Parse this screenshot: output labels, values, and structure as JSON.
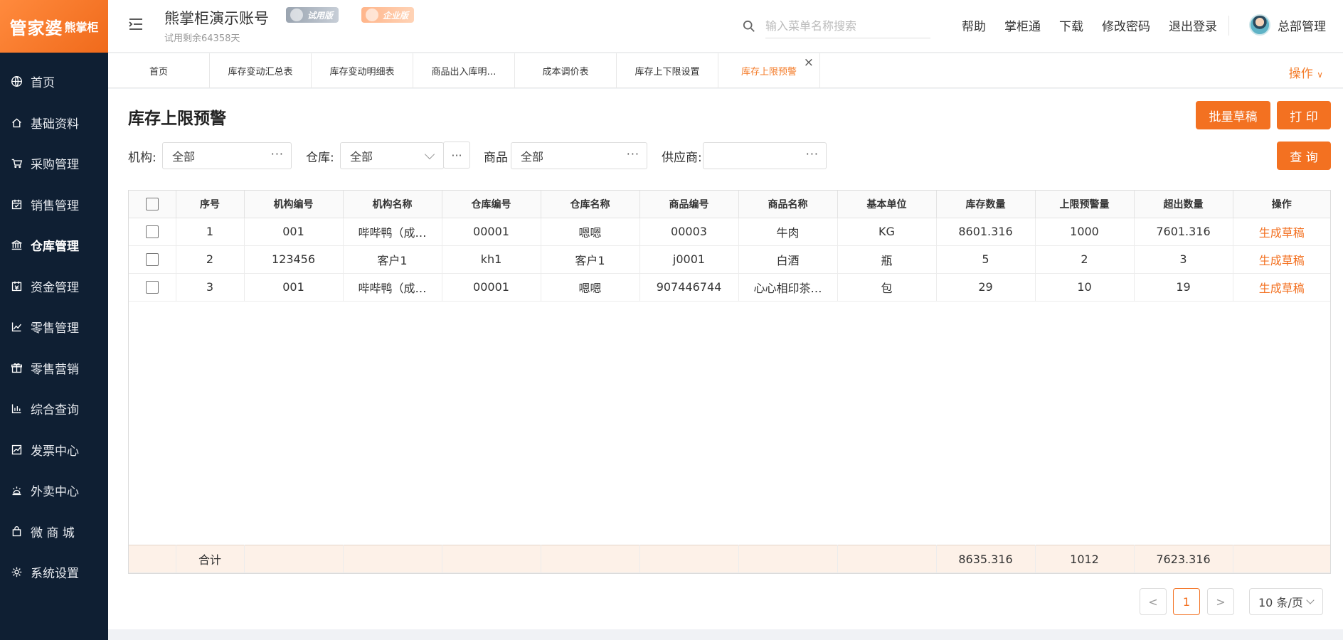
{
  "brand": {
    "logo_main": "管家婆",
    "logo_sub": "熊掌柜"
  },
  "sidebar": {
    "items": [
      {
        "label": "首页",
        "icon": "globe-icon"
      },
      {
        "label": "基础资料",
        "icon": "home-icon"
      },
      {
        "label": "采购管理",
        "icon": "cart-icon"
      },
      {
        "label": "销售管理",
        "icon": "calendar-icon"
      },
      {
        "label": "仓库管理",
        "icon": "bank-icon",
        "active": true
      },
      {
        "label": "资金管理",
        "icon": "money-calendar-icon"
      },
      {
        "label": "零售管理",
        "icon": "chart-icon"
      },
      {
        "label": "零售营销",
        "icon": "gift-icon"
      },
      {
        "label": "综合查询",
        "icon": "bar-chart-icon"
      },
      {
        "label": "发票中心",
        "icon": "line-chart-icon"
      },
      {
        "label": "外卖中心",
        "icon": "alarm-icon"
      },
      {
        "label": "微 商 城",
        "icon": "bag-icon"
      },
      {
        "label": "系统设置",
        "icon": "gear-icon"
      }
    ]
  },
  "header": {
    "account_title": "熊掌柜演示账号",
    "account_sub": "试用剩余64358天",
    "badge_trial": "试用版",
    "badge_enterprise": "企业版",
    "search_placeholder": "输入菜单名称搜索",
    "links": [
      "帮助",
      "掌柜通",
      "下载",
      "修改密码",
      "退出登录"
    ],
    "user_name": "总部管理"
  },
  "tabs": {
    "items": [
      "首页",
      "库存变动汇总表",
      "库存变动明细表",
      "商品出入库明…",
      "成本调价表",
      "库存上下限设置",
      "库存上限预警"
    ],
    "active_index": 6,
    "ops_label": "操作"
  },
  "page": {
    "title": "库存上限预警",
    "batch_button": "批量草稿",
    "print_button": "打 印",
    "query_button": "查 询"
  },
  "filters": {
    "org_label": "机构:",
    "org_value": "全部",
    "warehouse_label": "仓库:",
    "warehouse_value": "全部",
    "product_label": "商品",
    "product_value": "全部",
    "supplier_label": "供应商:",
    "supplier_value": "",
    "dots": "···"
  },
  "table": {
    "columns": [
      "序号",
      "机构编号",
      "机构名称",
      "仓库编号",
      "仓库名称",
      "商品编号",
      "商品名称",
      "基本单位",
      "库存数量",
      "上限预警量",
      "超出数量",
      "操作"
    ],
    "rows": [
      [
        "1",
        "001",
        "哔哔鸭（成…",
        "00001",
        "嗯嗯",
        "00003",
        "牛肉",
        "KG",
        "8601.316",
        "1000",
        "7601.316",
        "生成草稿"
      ],
      [
        "2",
        "123456",
        "客户1",
        "kh1",
        "客户1",
        "j0001",
        "白酒",
        "瓶",
        "5",
        "2",
        "3",
        "生成草稿"
      ],
      [
        "3",
        "001",
        "哔哔鸭（成…",
        "00001",
        "嗯嗯",
        "907446744",
        "心心相印茶…",
        "包",
        "29",
        "10",
        "19",
        "生成草稿"
      ]
    ],
    "total_label": "合计",
    "total_stock": "8635.316",
    "total_limit": "1012",
    "total_over": "7623.316"
  },
  "pager": {
    "prev": "<",
    "current": "1",
    "next": ">",
    "page_size": "10 条/页"
  },
  "colors": {
    "accent": "#f37121",
    "sidebar_bg": "#0f1f33"
  }
}
